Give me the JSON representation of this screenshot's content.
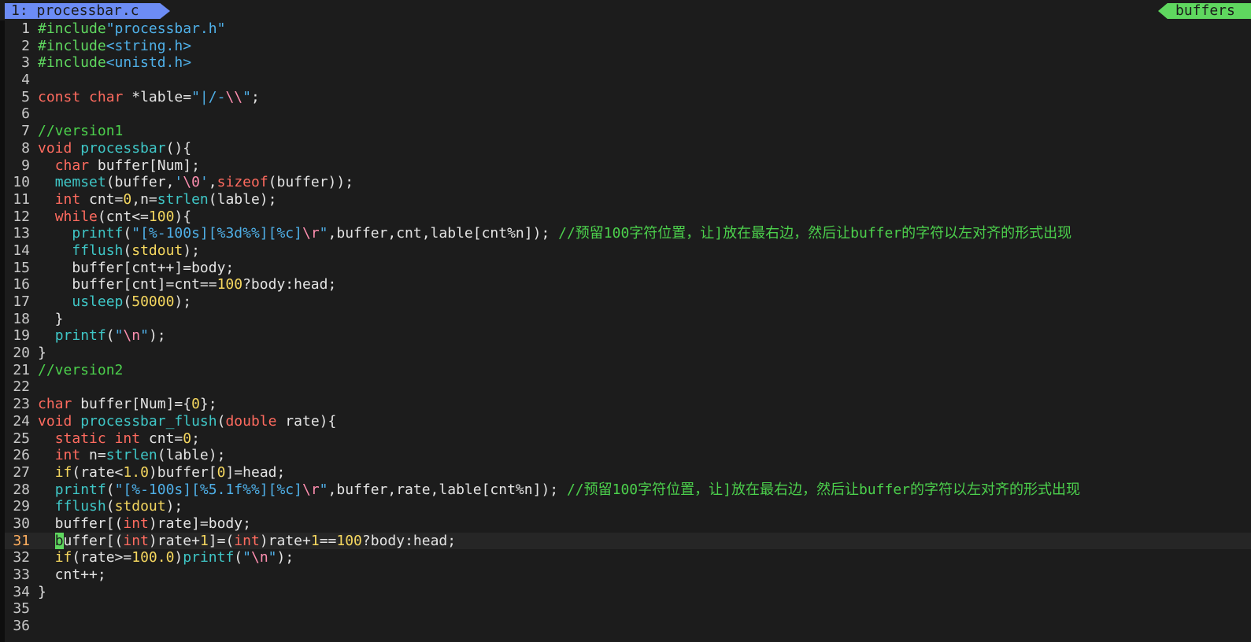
{
  "tabline": {
    "active_tab": "1: processbar.c",
    "right_label": "buffers"
  },
  "colors": {
    "background": "#1c1c1c",
    "tab_active": "#6c8cf5",
    "tab_buffers": "#5fd75f",
    "preprocessor": "#5fd75f",
    "string": "#4fb0e8",
    "keyword": "#ff6b5f",
    "function": "#3fc7c7",
    "number": "#f5d75f",
    "comment": "#4cd04c",
    "escape": "#ff8fb0"
  },
  "cursor": {
    "line": 31,
    "column": 3
  },
  "lines": [
    {
      "n": "1",
      "tokens": [
        [
          "pre",
          "#include"
        ],
        [
          "str",
          "\"processbar.h\""
        ]
      ]
    },
    {
      "n": "2",
      "tokens": [
        [
          "pre",
          "#include"
        ],
        [
          "str",
          "<string.h>"
        ]
      ]
    },
    {
      "n": "3",
      "tokens": [
        [
          "pre",
          "#include"
        ],
        [
          "str",
          "<unistd.h>"
        ]
      ]
    },
    {
      "n": "4",
      "tokens": []
    },
    {
      "n": "5",
      "tokens": [
        [
          "kw",
          "const"
        ],
        [
          "text",
          " "
        ],
        [
          "kw",
          "char"
        ],
        [
          "text",
          " *lable="
        ],
        [
          "str",
          "\"|/-"
        ],
        [
          "esc",
          "\\\\"
        ],
        [
          "str",
          "\""
        ],
        [
          "text",
          ";"
        ]
      ]
    },
    {
      "n": "6",
      "tokens": []
    },
    {
      "n": "7",
      "tokens": [
        [
          "cmt",
          "//version1"
        ]
      ]
    },
    {
      "n": "8",
      "tokens": [
        [
          "kw",
          "void"
        ],
        [
          "text",
          " "
        ],
        [
          "fn",
          "processbar"
        ],
        [
          "text",
          "(){"
        ]
      ]
    },
    {
      "n": "9",
      "tokens": [
        [
          "text",
          "  "
        ],
        [
          "kw",
          "char"
        ],
        [
          "text",
          " buffer[Num];"
        ]
      ]
    },
    {
      "n": "10",
      "tokens": [
        [
          "text",
          "  "
        ],
        [
          "fn",
          "memset"
        ],
        [
          "text",
          "(buffer,"
        ],
        [
          "str",
          "'"
        ],
        [
          "esc",
          "\\0"
        ],
        [
          "str",
          "'"
        ],
        [
          "text",
          ","
        ],
        [
          "kw",
          "sizeof"
        ],
        [
          "text",
          "(buffer));"
        ]
      ]
    },
    {
      "n": "11",
      "tokens": [
        [
          "text",
          "  "
        ],
        [
          "kw",
          "int"
        ],
        [
          "text",
          " cnt="
        ],
        [
          "num",
          "0"
        ],
        [
          "text",
          ",n="
        ],
        [
          "fn",
          "strlen"
        ],
        [
          "text",
          "(lable);"
        ]
      ]
    },
    {
      "n": "12",
      "tokens": [
        [
          "text",
          "  "
        ],
        [
          "kw",
          "while"
        ],
        [
          "text",
          "(cnt<="
        ],
        [
          "num",
          "100"
        ],
        [
          "text",
          "){"
        ]
      ]
    },
    {
      "n": "13",
      "tokens": [
        [
          "text",
          "    "
        ],
        [
          "fn",
          "printf"
        ],
        [
          "text",
          "("
        ],
        [
          "str",
          "\"[%-100s][%3d%%][%c]"
        ],
        [
          "esc",
          "\\r"
        ],
        [
          "str",
          "\""
        ],
        [
          "text",
          ",buffer,cnt,lable[cnt%n]); "
        ],
        [
          "cmt",
          "//预留100字符位置，让]放在最右边，然后让buffer的字符以左对齐的形式出现"
        ]
      ]
    },
    {
      "n": "14",
      "tokens": [
        [
          "text",
          "    "
        ],
        [
          "fn",
          "fflush"
        ],
        [
          "text",
          "("
        ],
        [
          "num",
          "stdout"
        ],
        [
          "text",
          ");"
        ]
      ]
    },
    {
      "n": "15",
      "tokens": [
        [
          "text",
          "    buffer[cnt++]=body;"
        ]
      ]
    },
    {
      "n": "16",
      "tokens": [
        [
          "text",
          "    buffer[cnt]=cnt=="
        ],
        [
          "num",
          "100"
        ],
        [
          "text",
          "?body:head;"
        ]
      ]
    },
    {
      "n": "17",
      "tokens": [
        [
          "text",
          "    "
        ],
        [
          "fn",
          "usleep"
        ],
        [
          "text",
          "("
        ],
        [
          "num",
          "50000"
        ],
        [
          "text",
          ");"
        ]
      ]
    },
    {
      "n": "18",
      "tokens": [
        [
          "text",
          "  }"
        ]
      ]
    },
    {
      "n": "19",
      "tokens": [
        [
          "text",
          "  "
        ],
        [
          "fn",
          "printf"
        ],
        [
          "text",
          "("
        ],
        [
          "str",
          "\""
        ],
        [
          "esc",
          "\\n"
        ],
        [
          "str",
          "\""
        ],
        [
          "text",
          ");"
        ]
      ]
    },
    {
      "n": "20",
      "tokens": [
        [
          "text",
          "}"
        ]
      ]
    },
    {
      "n": "21",
      "tokens": [
        [
          "cmt",
          "//version2"
        ]
      ]
    },
    {
      "n": "22",
      "tokens": []
    },
    {
      "n": "23",
      "tokens": [
        [
          "kw",
          "char"
        ],
        [
          "text",
          " buffer[Num]={"
        ],
        [
          "num",
          "0"
        ],
        [
          "text",
          "};"
        ]
      ]
    },
    {
      "n": "24",
      "tokens": [
        [
          "kw",
          "void"
        ],
        [
          "text",
          " "
        ],
        [
          "fn",
          "processbar_flush"
        ],
        [
          "text",
          "("
        ],
        [
          "kw",
          "double"
        ],
        [
          "text",
          " rate){"
        ]
      ]
    },
    {
      "n": "25",
      "tokens": [
        [
          "text",
          "  "
        ],
        [
          "kw",
          "static"
        ],
        [
          "text",
          " "
        ],
        [
          "kw",
          "int"
        ],
        [
          "text",
          " cnt="
        ],
        [
          "num",
          "0"
        ],
        [
          "text",
          ";"
        ]
      ]
    },
    {
      "n": "26",
      "tokens": [
        [
          "text",
          "  "
        ],
        [
          "kw",
          "int"
        ],
        [
          "text",
          " n="
        ],
        [
          "fn",
          "strlen"
        ],
        [
          "text",
          "(lable);"
        ]
      ]
    },
    {
      "n": "27",
      "tokens": [
        [
          "text",
          "  "
        ],
        [
          "num",
          "if"
        ],
        [
          "text",
          "(rate<"
        ],
        [
          "num",
          "1.0"
        ],
        [
          "text",
          ")buffer["
        ],
        [
          "num",
          "0"
        ],
        [
          "text",
          "]=head;"
        ]
      ]
    },
    {
      "n": "28",
      "tokens": [
        [
          "text",
          "  "
        ],
        [
          "fn",
          "printf"
        ],
        [
          "text",
          "("
        ],
        [
          "str",
          "\"[%-100s][%5.1f%%][%c]"
        ],
        [
          "esc",
          "\\r"
        ],
        [
          "str",
          "\""
        ],
        [
          "text",
          ",buffer,rate,lable[cnt%n]); "
        ],
        [
          "cmt",
          "//预留100字符位置，让]放在最右边，然后让buffer的字符以左对齐的形式出现"
        ]
      ]
    },
    {
      "n": "29",
      "tokens": [
        [
          "text",
          "  "
        ],
        [
          "fn",
          "fflush"
        ],
        [
          "text",
          "("
        ],
        [
          "num",
          "stdout"
        ],
        [
          "text",
          ");"
        ]
      ]
    },
    {
      "n": "30",
      "tokens": [
        [
          "text",
          "  buffer[("
        ],
        [
          "kw",
          "int"
        ],
        [
          "text",
          ")rate]=body;"
        ]
      ]
    },
    {
      "n": "31",
      "tokens": [
        [
          "text",
          "  "
        ],
        [
          "cursor",
          "b"
        ],
        [
          "text",
          "uffer[("
        ],
        [
          "kw",
          "int"
        ],
        [
          "text",
          ")rate+"
        ],
        [
          "num",
          "1"
        ],
        [
          "text",
          "]=("
        ],
        [
          "kw",
          "int"
        ],
        [
          "text",
          ")rate+"
        ],
        [
          "num",
          "1"
        ],
        [
          "text",
          "=="
        ],
        [
          "num",
          "100"
        ],
        [
          "text",
          "?body:head;"
        ]
      ]
    },
    {
      "n": "32",
      "tokens": [
        [
          "text",
          "  "
        ],
        [
          "num",
          "if"
        ],
        [
          "text",
          "(rate>="
        ],
        [
          "num",
          "100.0"
        ],
        [
          "text",
          ")"
        ],
        [
          "fn",
          "printf"
        ],
        [
          "text",
          "("
        ],
        [
          "str",
          "\""
        ],
        [
          "esc",
          "\\n"
        ],
        [
          "str",
          "\""
        ],
        [
          "text",
          ");"
        ]
      ]
    },
    {
      "n": "33",
      "tokens": [
        [
          "text",
          "  cnt++;"
        ]
      ]
    },
    {
      "n": "34",
      "tokens": [
        [
          "text",
          "}"
        ]
      ]
    },
    {
      "n": "35",
      "tokens": []
    },
    {
      "n": "36",
      "tokens": []
    }
  ]
}
